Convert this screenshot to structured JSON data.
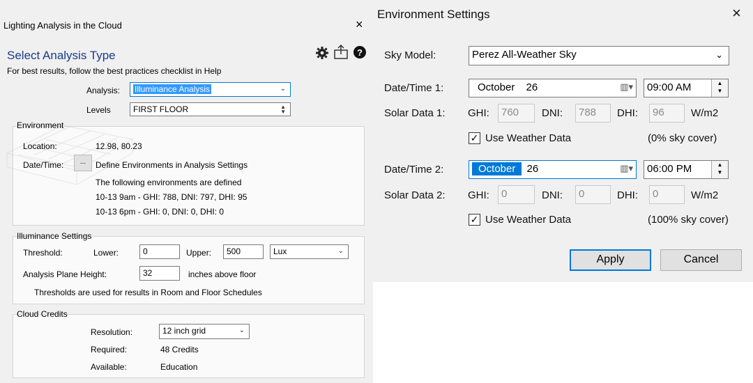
{
  "left": {
    "title": "Lighting Analysis in the Cloud",
    "heading": "Select Analysis Type",
    "subtitle": "For best results, follow the best practices checklist in Help",
    "analysis": {
      "label": "Analysis:",
      "value": "Illuminance Analysis"
    },
    "levels": {
      "label": "Levels",
      "value": "FIRST FLOOR"
    },
    "environment": {
      "title": "Environment",
      "location_label": "Location:",
      "location_value": "12.98, 80.23",
      "datetime_label": "Date/Time:",
      "datetime_button": "...",
      "datetime_text": "Define Environments in Analysis Settings",
      "env_note": "The following environments are defined",
      "env1": "10-13 9am - GHI: 788, DNI: 797, DHI: 95",
      "env2": "10-13 6pm - GHI: 0, DNI: 0, DHI: 0"
    },
    "illuminance": {
      "title": "Illuminance Settings",
      "threshold_label": "Threshold:",
      "lower_label": "Lower:",
      "lower_value": "0",
      "upper_label": "Upper:",
      "upper_value": "500",
      "unit": "Lux",
      "plane_label": "Analysis Plane Height:",
      "plane_value": "32",
      "plane_unit": "inches above floor",
      "note": "Thresholds are used for results in Room and Floor Schedules"
    },
    "credits": {
      "title": "Cloud Credits",
      "resolution_label": "Resolution:",
      "resolution_value": "12 inch grid",
      "required_label": "Required:",
      "required_value": "48 Credits",
      "available_label": "Available:",
      "available_value": "Education"
    }
  },
  "right": {
    "title": "Environment Settings",
    "sky_label": "Sky Model:",
    "sky_value": "Perez All-Weather Sky",
    "dt1": {
      "label": "Date/Time 1:",
      "month": "October",
      "day": "26",
      "time": "09:00 AM",
      "solar_label": "Solar Data 1:",
      "ghi_label": "GHI:",
      "ghi": "760",
      "dni_label": "DNI:",
      "dni": "788",
      "dhi_label": "DHI:",
      "dhi": "96",
      "unit": "W/m2",
      "weather_label": "Use Weather Data",
      "cover": "(0% sky cover)"
    },
    "dt2": {
      "label": "Date/Time 2:",
      "month": "October",
      "day": "26",
      "time": "06:00 PM",
      "solar_label": "Solar Data 2:",
      "ghi_label": "GHI:",
      "ghi": "0",
      "dni_label": "DNI:",
      "dni": "0",
      "dhi_label": "DHI:",
      "dhi": "0",
      "unit": "W/m2",
      "weather_label": "Use Weather Data",
      "cover": "(100% sky cover)"
    },
    "apply": "Apply",
    "cancel": "Cancel"
  },
  "icons": {
    "close": "×",
    "check": "✓",
    "down": "⌄"
  },
  "colors": {
    "heading": "#1a3a8c",
    "selection": "#3399ff",
    "default_button_border": "#0078d7"
  }
}
